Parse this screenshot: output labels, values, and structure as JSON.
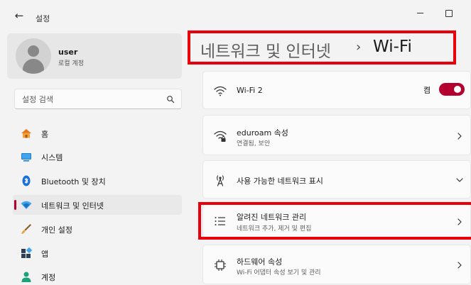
{
  "app": {
    "title": "설정"
  },
  "profile": {
    "name": "user",
    "account_type": "로컬 계정"
  },
  "search": {
    "placeholder": "설정 검색"
  },
  "sidebar": {
    "items": [
      {
        "label": "홈",
        "icon": "home-icon"
      },
      {
        "label": "시스템",
        "icon": "system-icon"
      },
      {
        "label": "Bluetooth 및 장치",
        "icon": "bluetooth-icon"
      },
      {
        "label": "네트워크 및 인터넷",
        "icon": "network-icon",
        "active": true
      },
      {
        "label": "개인 설정",
        "icon": "brush-icon"
      },
      {
        "label": "앱",
        "icon": "apps-icon"
      },
      {
        "label": "계정",
        "icon": "account-icon"
      }
    ]
  },
  "breadcrumb": {
    "parent": "네트워크 및 인터넷",
    "separator": "›",
    "current": "Wi-Fi"
  },
  "cards": {
    "wifi": {
      "title": "Wi-Fi 2",
      "toggle_label": "켬",
      "toggle_on": true
    },
    "eduroam": {
      "title": "eduroam 속성",
      "subtitle": "연결됨, 보안"
    },
    "available": {
      "title": "사용 가능한 네트워크 표시"
    },
    "known": {
      "title": "알려진 네트워크 관리",
      "subtitle": "네트워크 추가, 제거 및 편집"
    },
    "hardware": {
      "title": "하드웨어 속성",
      "subtitle": "Wi-Fi 어댑터 속성 보기 및 관리"
    }
  },
  "colors": {
    "accent": "#b4002f",
    "highlight": "#e8000b"
  }
}
